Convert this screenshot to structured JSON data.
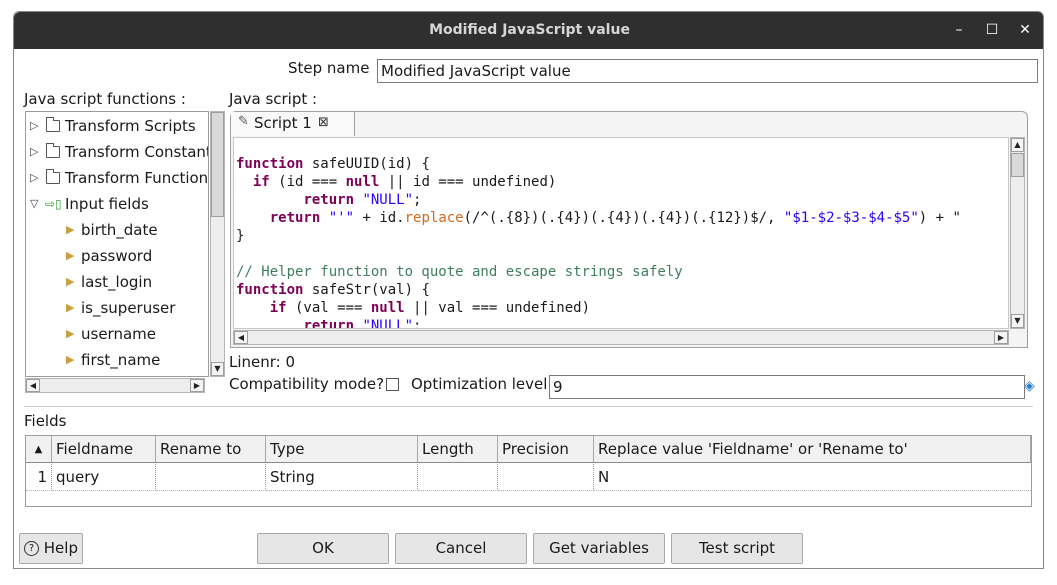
{
  "window": {
    "title": "Modified JavaScript value",
    "controls": {
      "minimize": "–",
      "maximize": "☐",
      "close": "✕"
    }
  },
  "step_name": {
    "label": "Step name",
    "value": "Modified JavaScript value"
  },
  "functions_panel": {
    "label": "Java script functions :",
    "tree": [
      {
        "label": "Transform Scripts",
        "expanded": false
      },
      {
        "label": "Transform Constant",
        "expanded": false
      },
      {
        "label": "Transform Function",
        "expanded": false
      },
      {
        "label": "Input fields",
        "expanded": true,
        "children": [
          "birth_date",
          "password",
          "last_login",
          "is_superuser",
          "username",
          "first_name"
        ]
      }
    ]
  },
  "script_panel": {
    "label": "Java script :",
    "tab": {
      "label": "Script 1",
      "close_icon": "⊠"
    }
  },
  "code": {
    "l1_kw": "function",
    "l1_rest": " safeUUID(id) {",
    "l2_kw1": "if",
    "l2_mid": " (id === ",
    "l2_kw2": "null",
    "l2_rest": " || id === undefined)",
    "l3_kw": "return",
    "l3_str": "\"NULL\"",
    "l3_end": ";",
    "l4_kw": "return",
    "l4_str1": "\"'\"",
    "l4_mid": " + id.",
    "l4_fn": "replace",
    "l4_regex": "(/^(.{8})(.{4})(.{4})(.{4})(.{12})$/, ",
    "l4_str2": "\"$1-$2-$3-$4-$5\"",
    "l4_tail": ") + \"",
    "l5": "}",
    "l7_comment": "// Helper function to quote and escape strings safely",
    "l8_kw": "function",
    "l8_rest": " safeStr(val) {",
    "l9_kw1": "if",
    "l9_mid": " (val === ",
    "l9_kw2": "null",
    "l9_rest": " || val === undefined)",
    "l10_kw": "return",
    "l10_str": "\"NULL\"",
    "l10_end": ";"
  },
  "linenr": "Linenr: 0",
  "compat": {
    "label": "Compatibility mode?",
    "checked": false
  },
  "optimization": {
    "label": "Optimization level",
    "value": "9"
  },
  "fields": {
    "label": "Fields",
    "columns": [
      "Fieldname",
      "Rename to",
      "Type",
      "Length",
      "Precision",
      "Replace value 'Fieldname' or 'Rename to'"
    ],
    "rows": [
      {
        "num": "1",
        "fieldname": "query",
        "rename": "",
        "type": "String",
        "length": "",
        "precision": "",
        "replace": "N"
      }
    ]
  },
  "buttons": {
    "help": "Help",
    "ok": "OK",
    "cancel": "Cancel",
    "get_variables": "Get variables",
    "test_script": "Test script"
  }
}
